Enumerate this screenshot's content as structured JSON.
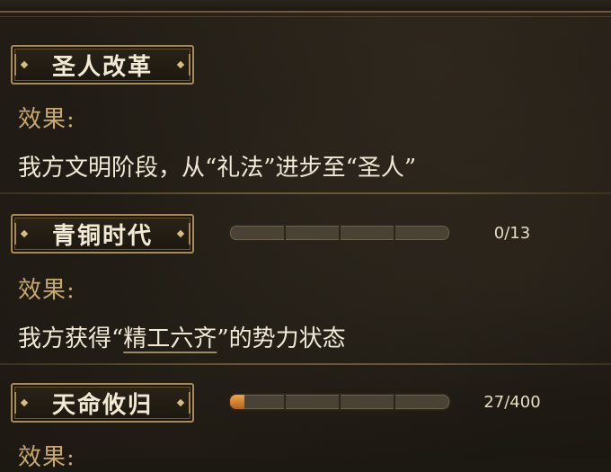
{
  "sections": [
    {
      "title": "圣人改革",
      "effect_label": "效果:",
      "description": "我方文明阶段，从“礼法”进步至“圣人”"
    },
    {
      "title": "青铜时代",
      "progress_text": "0/13",
      "progress_fraction": 0.0,
      "effect_label": "效果:",
      "desc_pre": "我方获得“",
      "desc_link": "精工六齐",
      "desc_post": "”的势力状态"
    },
    {
      "title": "天命攸归",
      "progress_text": "27/400",
      "progress_fraction": 0.0675,
      "effect_label": "效果:"
    }
  ],
  "colors": {
    "accent_gold": "#a88a55",
    "label_gold": "#c9a96b",
    "progress_fill": "#e08a34"
  }
}
